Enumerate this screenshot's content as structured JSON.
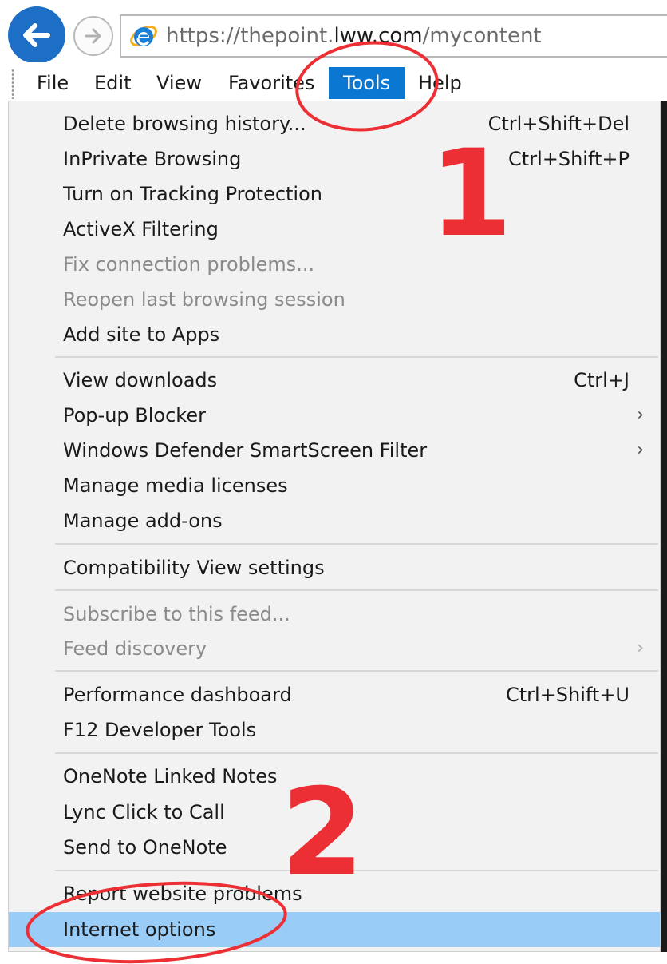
{
  "browser": {
    "url_prefix": "https://thepoint.",
    "url_domain": "lww.com",
    "url_suffix": "/mycontent",
    "back_icon": "back-arrow-icon",
    "forward_icon": "forward-arrow-icon",
    "logo_icon": "internet-explorer-icon"
  },
  "menu_bar": {
    "file": "File",
    "edit": "Edit",
    "view": "View",
    "favorites": "Favorites",
    "tools": "Tools",
    "help": "Help"
  },
  "tools_menu": {
    "delete_history": {
      "label": "Delete browsing history...",
      "shortcut": "Ctrl+Shift+Del"
    },
    "inprivate": {
      "label": "InPrivate Browsing",
      "shortcut": "Ctrl+Shift+P"
    },
    "tracking_protection": {
      "label": "Turn on Tracking Protection"
    },
    "activex_filtering": {
      "label": "ActiveX Filtering"
    },
    "fix_connection": {
      "label": "Fix connection problems..."
    },
    "reopen_session": {
      "label": "Reopen last browsing session"
    },
    "add_site_apps": {
      "label": "Add site to Apps"
    },
    "view_downloads": {
      "label": "View downloads",
      "shortcut": "Ctrl+J"
    },
    "popup_blocker": {
      "label": "Pop-up Blocker",
      "arrow": "›"
    },
    "smartscreen": {
      "label": "Windows Defender SmartScreen Filter",
      "arrow": "›"
    },
    "media_licenses": {
      "label": "Manage media licenses"
    },
    "addons": {
      "label": "Manage add-ons"
    },
    "compat_view": {
      "label": "Compatibility View settings"
    },
    "subscribe_feed": {
      "label": "Subscribe to this feed..."
    },
    "feed_discovery": {
      "label": "Feed discovery",
      "arrow": "›"
    },
    "perf_dashboard": {
      "label": "Performance dashboard",
      "shortcut": "Ctrl+Shift+U"
    },
    "dev_tools": {
      "label": "F12 Developer Tools"
    },
    "onenote_linked": {
      "label": "OneNote Linked Notes"
    },
    "lync_call": {
      "label": "Lync Click to Call"
    },
    "send_onenote": {
      "label": "Send to OneNote"
    },
    "report_problems": {
      "label": "Report website problems"
    },
    "internet_options": {
      "label": "Internet options"
    }
  },
  "annotations": {
    "step1": "1",
    "step2": "2",
    "color": "#ec2f34"
  },
  "colors": {
    "menu_active": "#0a78d2",
    "item_highlight": "#99cdf7",
    "dropdown_bg": "#f2f2f2"
  }
}
